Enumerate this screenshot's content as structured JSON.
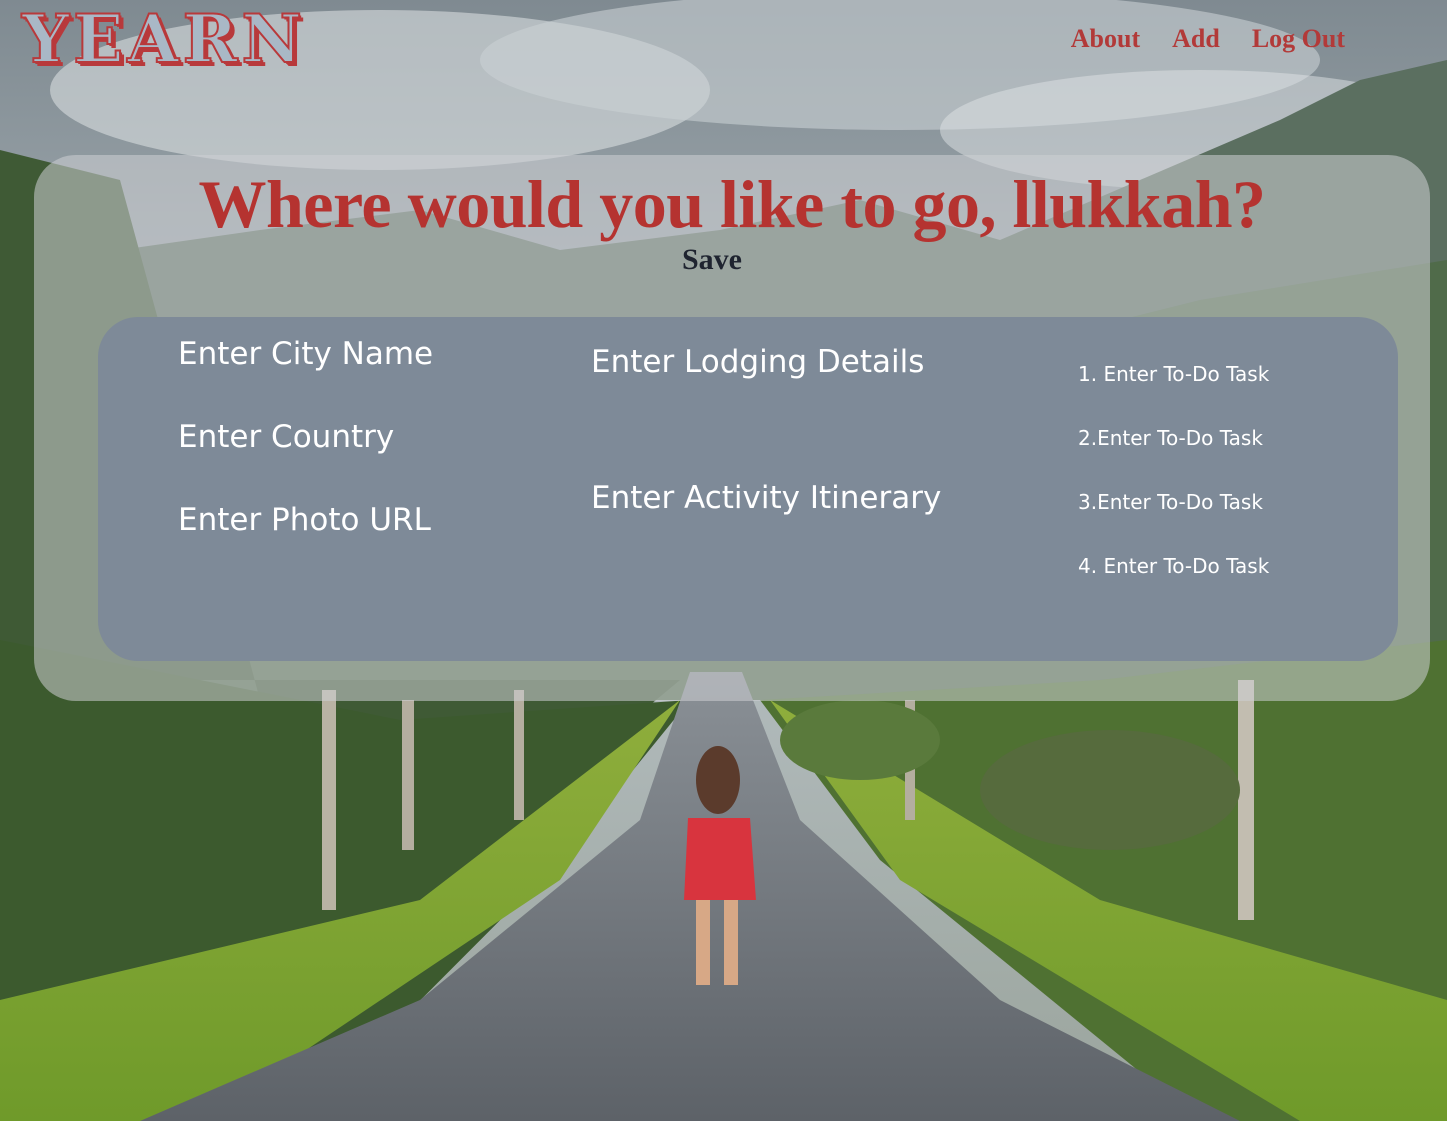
{
  "app": {
    "logo_text": "YEARN"
  },
  "nav": {
    "about": "About",
    "add": "Add",
    "logout": "Log Out"
  },
  "main": {
    "title": "Where would you like to go, llukkah?",
    "save_label": "Save"
  },
  "form": {
    "city_placeholder": "Enter City Name",
    "country_placeholder": "Enter Country",
    "photo_placeholder": "Enter Photo URL",
    "lodging_placeholder": "Enter Lodging Details",
    "activity_placeholder": "Enter Activity Itinerary",
    "tasks": [
      "1. Enter To-Do Task",
      "2.Enter To-Do Task",
      "3.Enter To-Do Task",
      "4. Enter To-Do Task"
    ]
  },
  "colors": {
    "accent": "#b53330",
    "panel": "#7e8a98",
    "save_text": "#1f2430"
  }
}
